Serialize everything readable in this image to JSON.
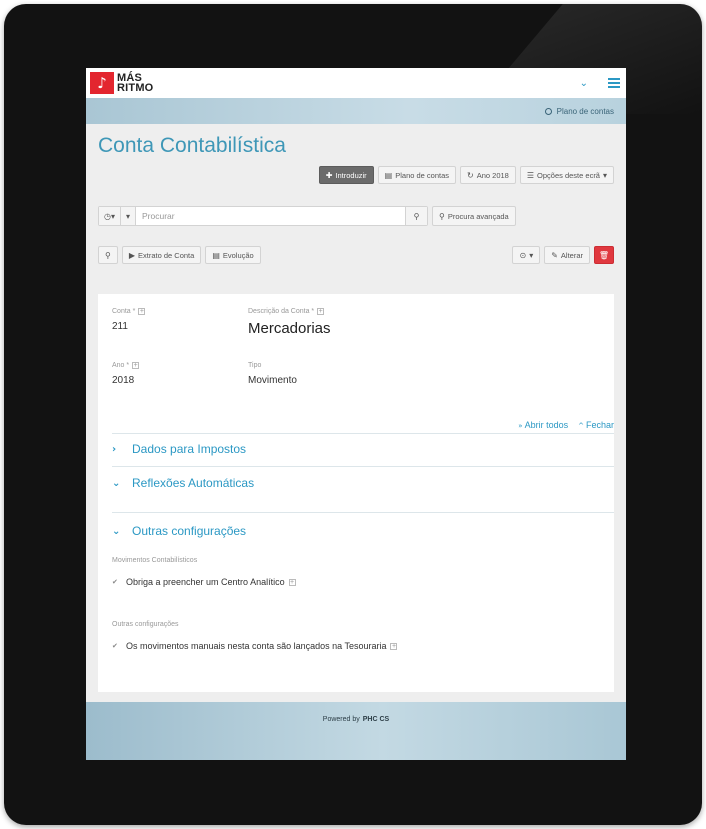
{
  "brand": {
    "line1": "MÁS",
    "line2": "RITMO",
    "mark": "♪"
  },
  "breadcrumb": "Plano de contas",
  "page_title": "Conta Contabilística",
  "toolbar": {
    "introduzir": "Introduzir",
    "plano": "Plano de contas",
    "ano": "Ano 2018",
    "opcoes": "Opções deste ecrã"
  },
  "search": {
    "placeholder": "Procurar",
    "advanced": "Procura avançada"
  },
  "actions": {
    "extrato": "Extrato de Conta",
    "evolucao": "Evolução",
    "alterar": "Alterar"
  },
  "fields": {
    "conta_label": "Conta *",
    "conta_value": "211",
    "descricao_label": "Descrição da Conta *",
    "descricao_value": "Mercadorias",
    "ano_label": "Ano *",
    "ano_value": "2018",
    "tipo_label": "Tipo",
    "tipo_value": "Movimento"
  },
  "expand": {
    "open_all": "Abrir todos",
    "close": "Fechar"
  },
  "sections": {
    "impostos": "Dados para Impostos",
    "reflexoes": "Reflexões Automáticas",
    "outras": "Outras configurações"
  },
  "groups": {
    "movimentos_label": "Movimentos Contabilísticos",
    "centro_analitico": "Obriga a preencher um Centro Analítico",
    "outras_label": "Outras configurações",
    "tesouraria": "Os movimentos manuais nesta conta são lançados na Tesouraria"
  },
  "footer": {
    "powered": "Powered by",
    "product": "PHC CS"
  },
  "colors": {
    "accent": "#2b98c4",
    "title": "#3e97b7",
    "danger": "#e0383f",
    "brand": "#e3262f"
  }
}
